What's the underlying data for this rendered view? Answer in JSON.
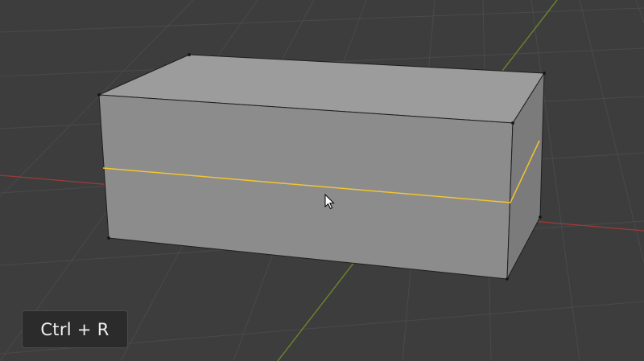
{
  "viewport": {
    "shortcut_label": "Ctrl + R",
    "object": "cube",
    "active_tool": "loop-cut",
    "mouse_cursor_icon": "arrow-cursor-icon"
  },
  "colors": {
    "background": "#3d3d3d",
    "grid": "#4a4a4a",
    "x_axis": "#9a3a3a",
    "y_axis": "#6f8a2a",
    "cube_front": "#8c8c8c",
    "cube_top": "#9c9c9c",
    "cube_side": "#7c7c7c",
    "edge": "#1e1e1e",
    "loop_cut_highlight": "#f2c530"
  }
}
